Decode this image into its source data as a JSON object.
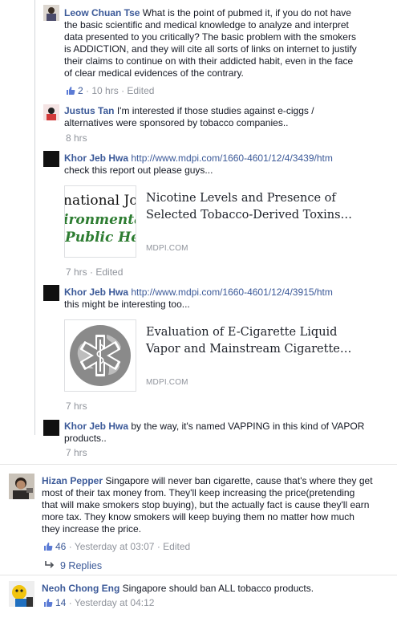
{
  "comments": [
    {
      "author": "Leow Chuan Tse",
      "text_lines": [
        "What is the point of pubmed it, if you do not have",
        "the basic scientific and medical knowledge to analyze and interpret",
        "data presented to you critically? The basic problem with the smokers",
        "is ADDICTION, and they will cite all sorts of links on internet to justify",
        "their claims to continue on with their addicted habit, even in the face",
        "of clear medical evidences of the contrary."
      ],
      "likes": "2",
      "time": "10 hrs",
      "edited": "Edited"
    },
    {
      "author": "Justus Tan",
      "text_lines": [
        "I'm interested if those studies against e-ciggs /",
        "alternatives were sponsored by tobacco companies.."
      ],
      "time": "8 hrs"
    },
    {
      "author": "Khor Jeb Hwa",
      "link": "http://www.mdpi.com/1660-4601/12/4/3439/htm",
      "text": "check this report out please guys...",
      "card": {
        "image_lines": [
          "national Jou",
          "ironmental",
          "Public Hea"
        ],
        "title_lines": [
          "Nicotine Levels and Presence of",
          "Selected Tobacco-Derived Toxins…"
        ],
        "domain": "MDPI.COM"
      },
      "time": "7 hrs",
      "edited": "Edited"
    },
    {
      "author": "Khor Jeb Hwa",
      "link": "http://www.mdpi.com/1660-4601/12/4/3915/htm",
      "text": "this might be interesting too...",
      "card": {
        "title_lines": [
          "Evaluation of E-Cigarette Liquid",
          "Vapor and Mainstream Cigarette…"
        ],
        "domain": "MDPI.COM"
      },
      "time": "7 hrs"
    },
    {
      "author": "Khor Jeb Hwa",
      "text_lines": [
        "by the way, it's named VAPPING in this kind of VAPOR",
        "products.."
      ],
      "time": "7 hrs"
    },
    {
      "author": "Hizan Pepper",
      "text_lines": [
        "Singapore will never ban cigarette, cause that's where they get",
        "most of their tax money from. They'll keep increasing the price(pretending",
        "that will make smokers stop buying), but the actually fact is cause they'll earn",
        "more tax. They know smokers will keep buying them no matter how much",
        "they increase the price."
      ],
      "likes": "46",
      "time": "Yesterday at 03:07",
      "edited": "Edited",
      "replies": "9 Replies"
    },
    {
      "author": "Neoh Chong Eng",
      "text": "Singapore should ban ALL tobacco products.",
      "likes": "14",
      "time": "Yesterday at 04:12"
    }
  ],
  "separator": "·",
  "colors": {
    "link": "#3b5998",
    "meta": "#90949c",
    "journal_green": "#2e7d32"
  }
}
